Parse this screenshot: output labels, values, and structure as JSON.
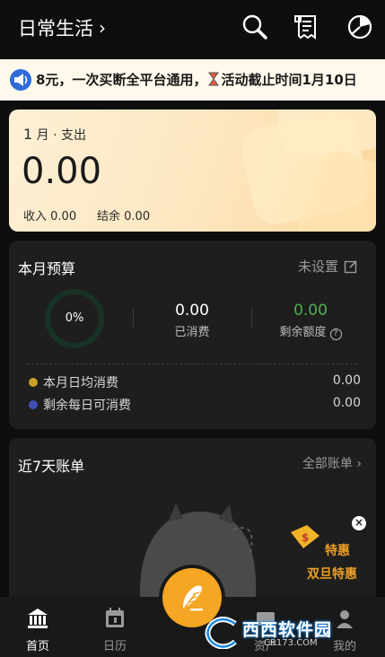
{
  "header": {
    "book_title": "日常生活",
    "chevron": "›",
    "icons": [
      "search-icon",
      "bill-list-icon",
      "pie-chart-icon"
    ]
  },
  "announcement": {
    "text_before": "8元，一次买断全平台通用，",
    "text_after": "活动截止时间1月10日",
    "icons": [
      "speaker-icon",
      "hourglass-icon"
    ]
  },
  "summary": {
    "month": "1",
    "month_suffix": "月 · 支出",
    "expense": "0.00",
    "income_label": "收入",
    "income": "0.00",
    "balance_label": "结余",
    "balance": "0.00"
  },
  "budget": {
    "title": "本月预算",
    "action": "未设置",
    "percent": "0%",
    "spent_value": "0.00",
    "spent_label": "已消费",
    "remaining_value": "0.00",
    "remaining_label": "剩余额度",
    "help_glyph": "?",
    "daily_avg_label": "本月日均消费",
    "daily_avg_value": "0.00",
    "daily_left_label": "剩余每日可消费",
    "daily_left_value": "0.00",
    "colors": {
      "remaining": "#4caf50",
      "daily_avg_dot": "#c9a227",
      "daily_left_dot": "#3f51b5",
      "ring": "#183226"
    }
  },
  "recent": {
    "title": "近7天账单",
    "all_link": "全部账单",
    "chevron": "›"
  },
  "promo": {
    "line1": "特惠",
    "line2": "双旦特惠",
    "close": "×"
  },
  "nav": {
    "items": [
      {
        "label": "首页",
        "icon": "bank-icon",
        "active": true
      },
      {
        "label": "日历",
        "icon": "calendar-icon",
        "active": false
      },
      {
        "label": "资产",
        "icon": "wallet-icon",
        "active": false
      },
      {
        "label": "我的",
        "icon": "user-icon",
        "active": false
      }
    ],
    "fab_icon": "quill-pen-icon",
    "accent": "#f5a623"
  },
  "watermark": {
    "title": "西西软件园",
    "subtitle": "CR173.COM"
  }
}
